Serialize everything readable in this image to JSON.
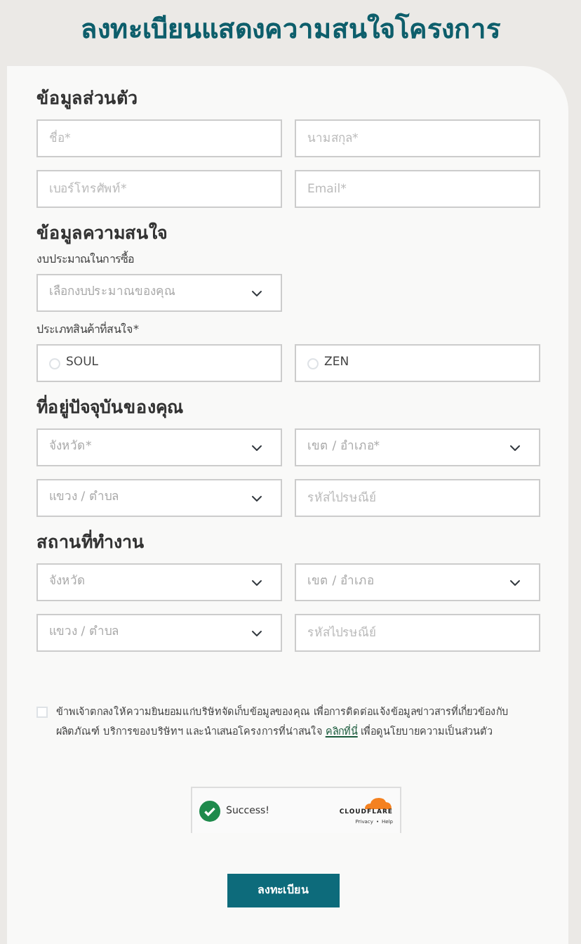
{
  "title": "ลงทะเบียนแสดงความสนใจโครงการ",
  "sections": [
    {
      "heading": "ข้อมูลส่วนตัว",
      "items": [
        {
          "kind": "fields",
          "fields": [
            {
              "kind": "input",
              "placeholder": "ชื่อ*"
            },
            {
              "kind": "input",
              "placeholder": "นามสกุล*"
            }
          ]
        },
        {
          "kind": "fields",
          "fields": [
            {
              "kind": "input",
              "placeholder": "เบอร์โทรศัพท์*"
            },
            {
              "kind": "input",
              "placeholder": "Email*"
            }
          ]
        }
      ]
    },
    {
      "heading": "ข้อมูลความสนใจ",
      "items": [
        {
          "kind": "label",
          "text": "งบประมาณในการซื้อ"
        },
        {
          "kind": "fields",
          "fields": [
            {
              "kind": "select",
              "placeholder": "เลือกงบประมาณของคุณ"
            }
          ]
        },
        {
          "kind": "label",
          "text": "ประเภทสินค้าที่สนใจ*"
        },
        {
          "kind": "radios",
          "options": [
            {
              "label": "SOUL",
              "selected": false
            },
            {
              "label": "ZEN",
              "selected": false
            }
          ]
        }
      ]
    },
    {
      "heading": "ที่อยู่ปัจจุบันของคุณ",
      "items": [
        {
          "kind": "fields",
          "fields": [
            {
              "kind": "select",
              "placeholder": "จังหวัด*"
            },
            {
              "kind": "select",
              "placeholder": "เขต / อำเภอ*"
            }
          ]
        },
        {
          "kind": "fields",
          "fields": [
            {
              "kind": "select",
              "placeholder": "แขวง / ตำบล"
            },
            {
              "kind": "input",
              "placeholder": "รหัสไปรษณีย์"
            }
          ]
        }
      ]
    },
    {
      "heading": "สถานที่ทำงาน",
      "items": [
        {
          "kind": "fields",
          "fields": [
            {
              "kind": "select",
              "placeholder": "จังหวัด"
            },
            {
              "kind": "select",
              "placeholder": "เขต / อำเภอ"
            }
          ]
        },
        {
          "kind": "fields",
          "fields": [
            {
              "kind": "select",
              "placeholder": "แขวง / ตำบล"
            },
            {
              "kind": "input",
              "placeholder": "รหัสไปรษณีย์"
            }
          ]
        }
      ]
    }
  ],
  "consent": {
    "checked": false,
    "text_before": "ข้าพเจ้าตกลงให้ความยินยอมแก่บริษัทจัดเก็บข้อมูลของคุณ เพื่อการติดต่อแจ้งข้อมูลข่าวสารที่เกี่ยวข้องกับผลิตภัณฑ์ บริการของบริษัทฯ และนำเสนอโครงการที่น่าสนใจ",
    "link": "คลิกที่นี่",
    "text_after": "เพื่อดูนโยบายความเป็นส่วนตัว"
  },
  "captcha": {
    "status": "Success!",
    "brand": "CLOUDFLARE",
    "links": [
      "Privacy",
      "Help"
    ],
    "separator": "•"
  },
  "submit": "ลงทะเบียน"
}
